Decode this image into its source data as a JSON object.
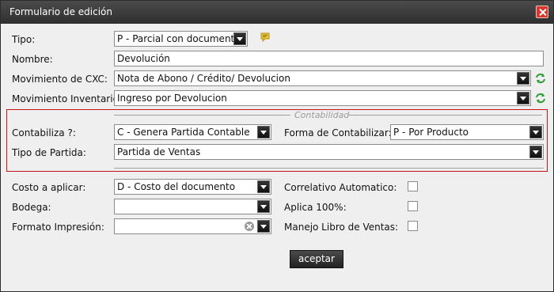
{
  "window": {
    "title": "Formulario de edición"
  },
  "fields": {
    "tipo": {
      "label": "Tipo:",
      "value": "P - Parcial con documento"
    },
    "nombre": {
      "label": "Nombre:",
      "value": "Devolución"
    },
    "movimiento_cxc": {
      "label": "Movimiento de CXC:",
      "value": "Nota de Abono / Crédito/ Devolucion"
    },
    "movimiento_inventario": {
      "label": "Movimiento Inventario:",
      "value": "Ingreso por Devolucion"
    },
    "contabiliza": {
      "label": "Contabiliza ?:",
      "value": "C - Genera Partida Contable"
    },
    "forma_contabilizar": {
      "label": "Forma de Contabilizar:",
      "value": "P - Por Producto"
    },
    "tipo_partida": {
      "label": "Tipo de Partida:",
      "value": "Partida de Ventas"
    },
    "costo_aplicar": {
      "label": "Costo a aplicar:",
      "value": "D - Costo del documento"
    },
    "bodega": {
      "label": "Bodega:",
      "value": ""
    },
    "formato_impresion": {
      "label": "Formato Impresión:",
      "value": ""
    }
  },
  "contabilidad": {
    "legend": "Contabilidad"
  },
  "checkboxes": {
    "correlativo": {
      "label": "Correlativo Automatico:",
      "checked": false
    },
    "aplica100": {
      "label": "Aplica 100%:",
      "checked": false
    },
    "libro_ventas": {
      "label": "Manejo Libro de Ventas:",
      "checked": false
    }
  },
  "actions": {
    "accept": "aceptar"
  },
  "colors": {
    "group_border": "#c6161d",
    "refresh": "#2f9d34",
    "note": "#e4c53b"
  }
}
